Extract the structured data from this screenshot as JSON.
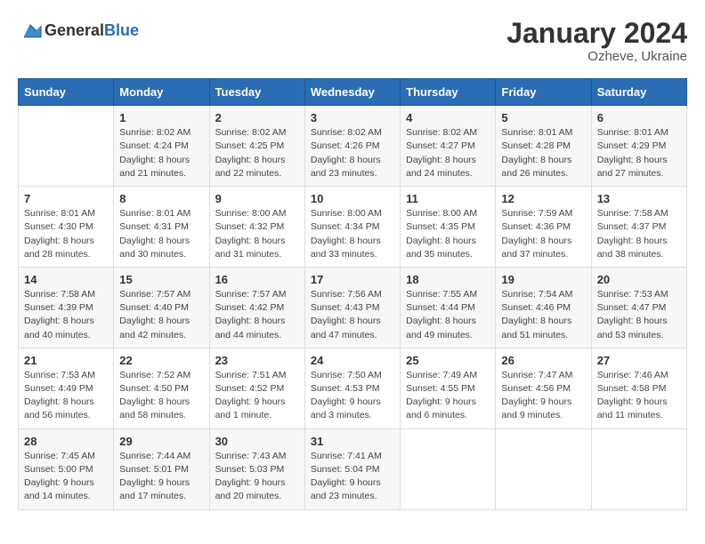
{
  "logo": {
    "general": "General",
    "blue": "Blue"
  },
  "header": {
    "month": "January 2024",
    "location": "Ozheve, Ukraine"
  },
  "columns": [
    "Sunday",
    "Monday",
    "Tuesday",
    "Wednesday",
    "Thursday",
    "Friday",
    "Saturday"
  ],
  "weeks": [
    [
      {
        "day": "",
        "sunrise": "",
        "sunset": "",
        "daylight": ""
      },
      {
        "day": "1",
        "sunrise": "Sunrise: 8:02 AM",
        "sunset": "Sunset: 4:24 PM",
        "daylight": "Daylight: 8 hours and 21 minutes."
      },
      {
        "day": "2",
        "sunrise": "Sunrise: 8:02 AM",
        "sunset": "Sunset: 4:25 PM",
        "daylight": "Daylight: 8 hours and 22 minutes."
      },
      {
        "day": "3",
        "sunrise": "Sunrise: 8:02 AM",
        "sunset": "Sunset: 4:26 PM",
        "daylight": "Daylight: 8 hours and 23 minutes."
      },
      {
        "day": "4",
        "sunrise": "Sunrise: 8:02 AM",
        "sunset": "Sunset: 4:27 PM",
        "daylight": "Daylight: 8 hours and 24 minutes."
      },
      {
        "day": "5",
        "sunrise": "Sunrise: 8:01 AM",
        "sunset": "Sunset: 4:28 PM",
        "daylight": "Daylight: 8 hours and 26 minutes."
      },
      {
        "day": "6",
        "sunrise": "Sunrise: 8:01 AM",
        "sunset": "Sunset: 4:29 PM",
        "daylight": "Daylight: 8 hours and 27 minutes."
      }
    ],
    [
      {
        "day": "7",
        "sunrise": "Sunrise: 8:01 AM",
        "sunset": "Sunset: 4:30 PM",
        "daylight": "Daylight: 8 hours and 28 minutes."
      },
      {
        "day": "8",
        "sunrise": "Sunrise: 8:01 AM",
        "sunset": "Sunset: 4:31 PM",
        "daylight": "Daylight: 8 hours and 30 minutes."
      },
      {
        "day": "9",
        "sunrise": "Sunrise: 8:00 AM",
        "sunset": "Sunset: 4:32 PM",
        "daylight": "Daylight: 8 hours and 31 minutes."
      },
      {
        "day": "10",
        "sunrise": "Sunrise: 8:00 AM",
        "sunset": "Sunset: 4:34 PM",
        "daylight": "Daylight: 8 hours and 33 minutes."
      },
      {
        "day": "11",
        "sunrise": "Sunrise: 8:00 AM",
        "sunset": "Sunset: 4:35 PM",
        "daylight": "Daylight: 8 hours and 35 minutes."
      },
      {
        "day": "12",
        "sunrise": "Sunrise: 7:59 AM",
        "sunset": "Sunset: 4:36 PM",
        "daylight": "Daylight: 8 hours and 37 minutes."
      },
      {
        "day": "13",
        "sunrise": "Sunrise: 7:58 AM",
        "sunset": "Sunset: 4:37 PM",
        "daylight": "Daylight: 8 hours and 38 minutes."
      }
    ],
    [
      {
        "day": "14",
        "sunrise": "Sunrise: 7:58 AM",
        "sunset": "Sunset: 4:39 PM",
        "daylight": "Daylight: 8 hours and 40 minutes."
      },
      {
        "day": "15",
        "sunrise": "Sunrise: 7:57 AM",
        "sunset": "Sunset: 4:40 PM",
        "daylight": "Daylight: 8 hours and 42 minutes."
      },
      {
        "day": "16",
        "sunrise": "Sunrise: 7:57 AM",
        "sunset": "Sunset: 4:42 PM",
        "daylight": "Daylight: 8 hours and 44 minutes."
      },
      {
        "day": "17",
        "sunrise": "Sunrise: 7:56 AM",
        "sunset": "Sunset: 4:43 PM",
        "daylight": "Daylight: 8 hours and 47 minutes."
      },
      {
        "day": "18",
        "sunrise": "Sunrise: 7:55 AM",
        "sunset": "Sunset: 4:44 PM",
        "daylight": "Daylight: 8 hours and 49 minutes."
      },
      {
        "day": "19",
        "sunrise": "Sunrise: 7:54 AM",
        "sunset": "Sunset: 4:46 PM",
        "daylight": "Daylight: 8 hours and 51 minutes."
      },
      {
        "day": "20",
        "sunrise": "Sunrise: 7:53 AM",
        "sunset": "Sunset: 4:47 PM",
        "daylight": "Daylight: 8 hours and 53 minutes."
      }
    ],
    [
      {
        "day": "21",
        "sunrise": "Sunrise: 7:53 AM",
        "sunset": "Sunset: 4:49 PM",
        "daylight": "Daylight: 8 hours and 56 minutes."
      },
      {
        "day": "22",
        "sunrise": "Sunrise: 7:52 AM",
        "sunset": "Sunset: 4:50 PM",
        "daylight": "Daylight: 8 hours and 58 minutes."
      },
      {
        "day": "23",
        "sunrise": "Sunrise: 7:51 AM",
        "sunset": "Sunset: 4:52 PM",
        "daylight": "Daylight: 9 hours and 1 minute."
      },
      {
        "day": "24",
        "sunrise": "Sunrise: 7:50 AM",
        "sunset": "Sunset: 4:53 PM",
        "daylight": "Daylight: 9 hours and 3 minutes."
      },
      {
        "day": "25",
        "sunrise": "Sunrise: 7:49 AM",
        "sunset": "Sunset: 4:55 PM",
        "daylight": "Daylight: 9 hours and 6 minutes."
      },
      {
        "day": "26",
        "sunrise": "Sunrise: 7:47 AM",
        "sunset": "Sunset: 4:56 PM",
        "daylight": "Daylight: 9 hours and 9 minutes."
      },
      {
        "day": "27",
        "sunrise": "Sunrise: 7:46 AM",
        "sunset": "Sunset: 4:58 PM",
        "daylight": "Daylight: 9 hours and 11 minutes."
      }
    ],
    [
      {
        "day": "28",
        "sunrise": "Sunrise: 7:45 AM",
        "sunset": "Sunset: 5:00 PM",
        "daylight": "Daylight: 9 hours and 14 minutes."
      },
      {
        "day": "29",
        "sunrise": "Sunrise: 7:44 AM",
        "sunset": "Sunset: 5:01 PM",
        "daylight": "Daylight: 9 hours and 17 minutes."
      },
      {
        "day": "30",
        "sunrise": "Sunrise: 7:43 AM",
        "sunset": "Sunset: 5:03 PM",
        "daylight": "Daylight: 9 hours and 20 minutes."
      },
      {
        "day": "31",
        "sunrise": "Sunrise: 7:41 AM",
        "sunset": "Sunset: 5:04 PM",
        "daylight": "Daylight: 9 hours and 23 minutes."
      },
      {
        "day": "",
        "sunrise": "",
        "sunset": "",
        "daylight": ""
      },
      {
        "day": "",
        "sunrise": "",
        "sunset": "",
        "daylight": ""
      },
      {
        "day": "",
        "sunrise": "",
        "sunset": "",
        "daylight": ""
      }
    ]
  ]
}
